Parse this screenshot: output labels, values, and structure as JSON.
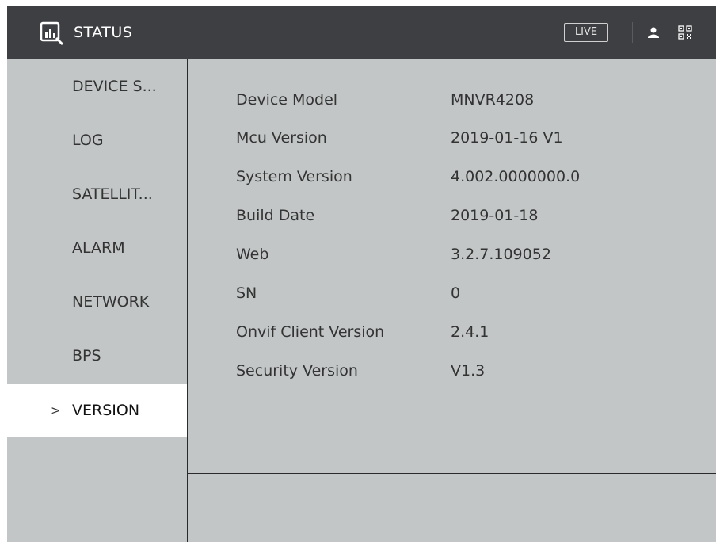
{
  "header": {
    "title": "STATUS",
    "live_label": "LIVE",
    "icons": [
      "status-logo-icon",
      "user-icon",
      "qr-code-icon"
    ]
  },
  "sidebar": {
    "items": [
      {
        "label": "DEVICE S..."
      },
      {
        "label": "LOG"
      },
      {
        "label": "SATELLIT..."
      },
      {
        "label": "ALARM"
      },
      {
        "label": "NETWORK"
      },
      {
        "label": "BPS"
      },
      {
        "label": "VERSION",
        "active": true,
        "chevron": ">"
      }
    ]
  },
  "version_info": [
    {
      "key": "Device Model",
      "value": "MNVR4208"
    },
    {
      "key": "Mcu Version",
      "value": "2019-01-16 V1"
    },
    {
      "key": "System Version",
      "value": "4.002.0000000.0"
    },
    {
      "key": "Build Date",
      "value": "2019-01-18"
    },
    {
      "key": "Web",
      "value": "3.2.7.109052"
    },
    {
      "key": "SN",
      "value": "0"
    },
    {
      "key": "Onvif Client Version",
      "value": "2.4.1"
    },
    {
      "key": "Security Version",
      "value": "V1.3"
    }
  ],
  "colors": {
    "header_bg": "#3e3f42",
    "panel_bg": "#c2c6c6",
    "active_item_bg": "#ffffff",
    "text": "#333333"
  }
}
